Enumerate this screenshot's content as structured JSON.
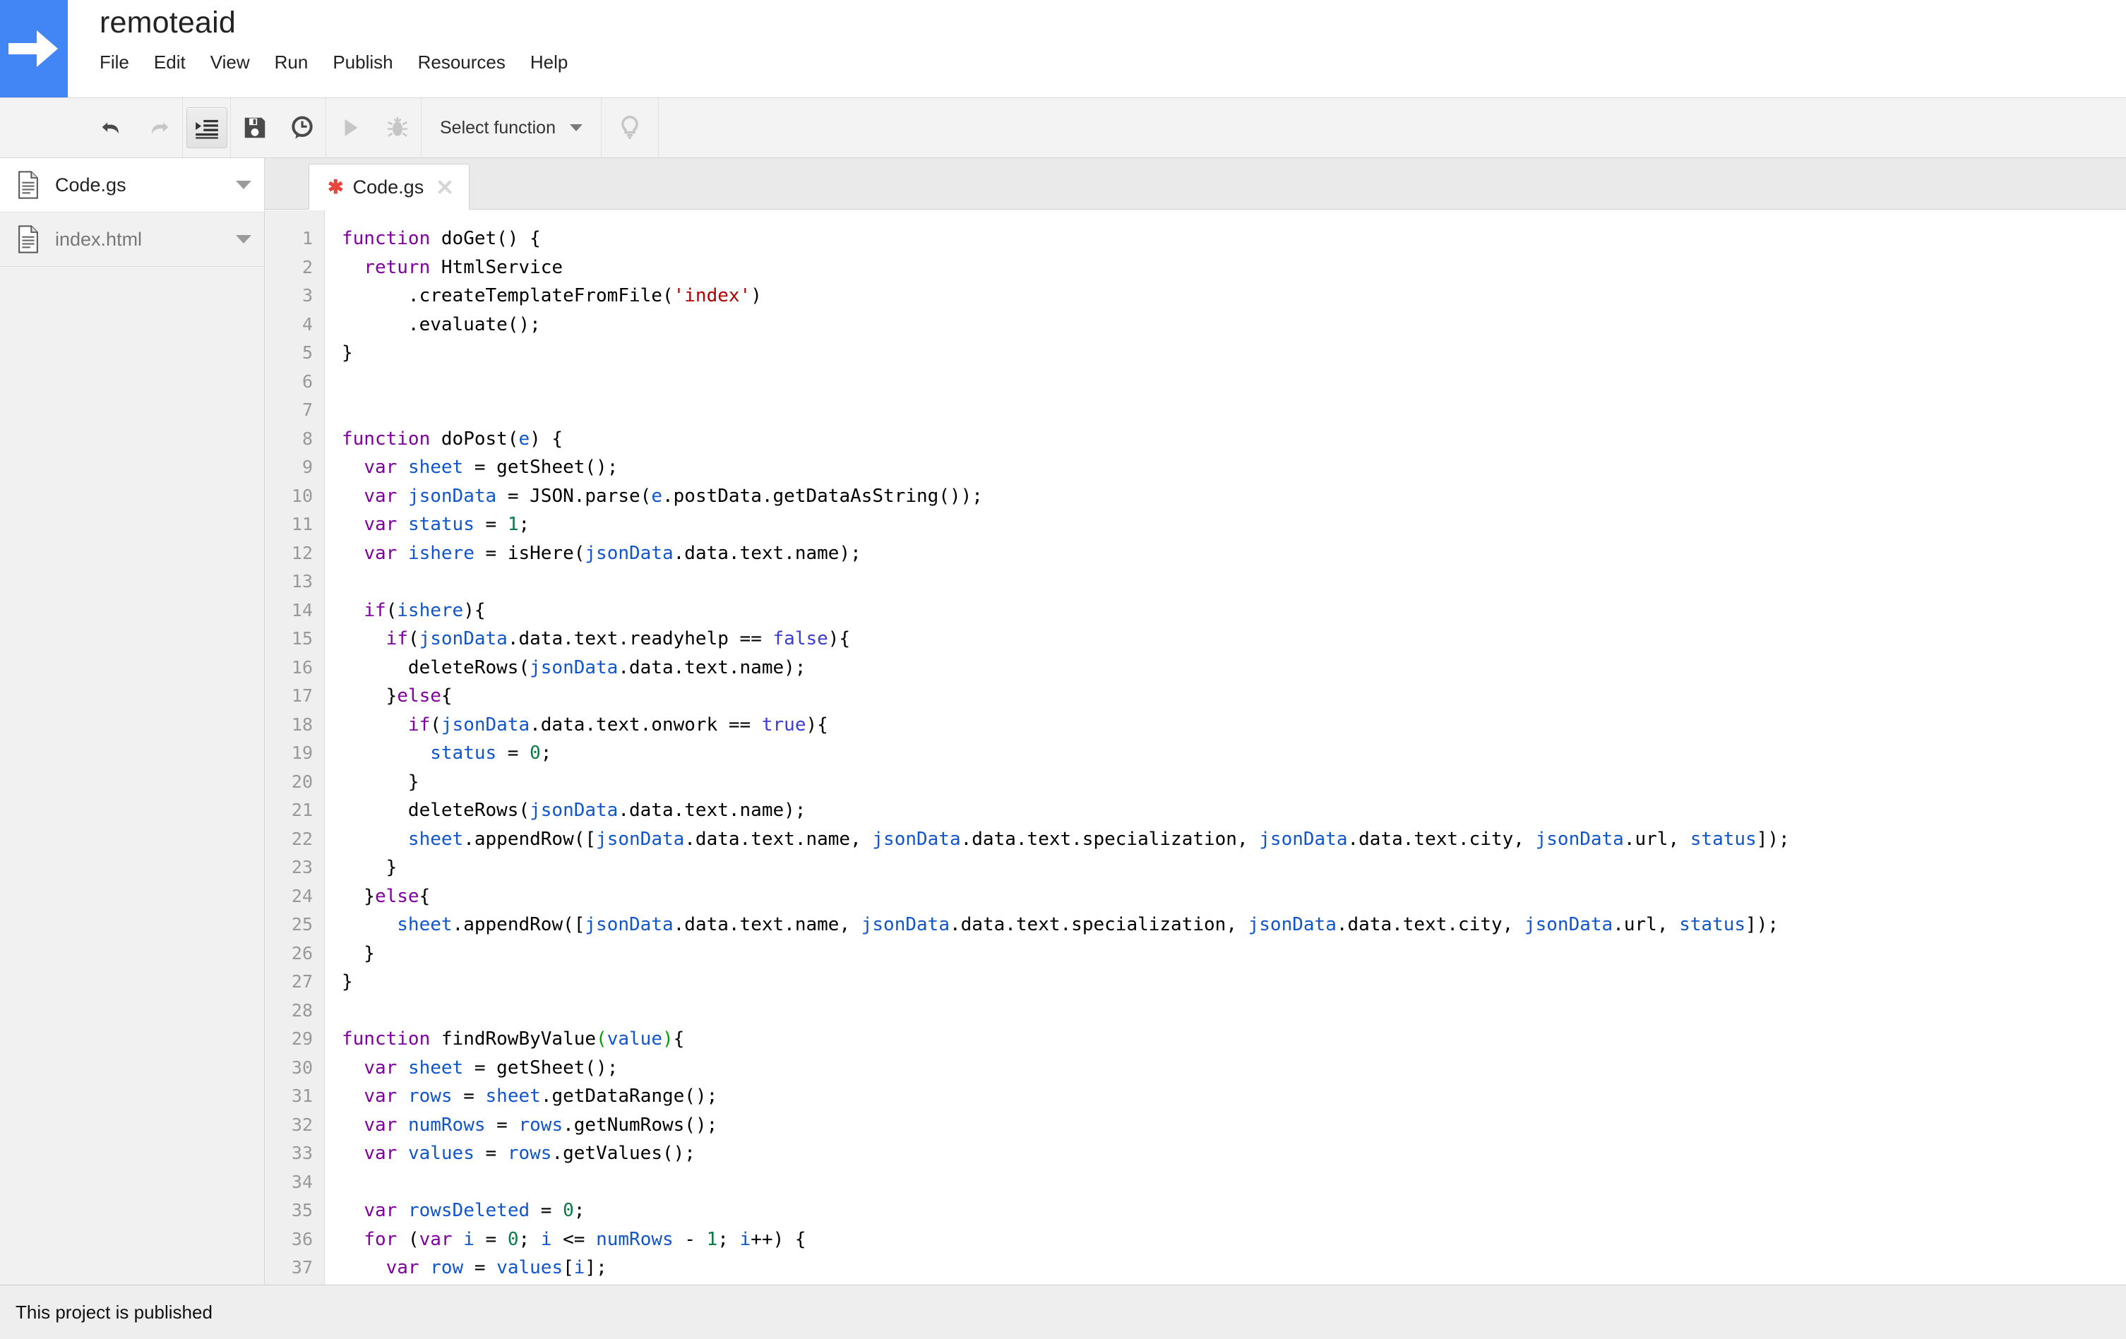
{
  "header": {
    "logo_icon": "arrow-right-icon",
    "logo_color": "#4285f4",
    "project_title": "remoteaid",
    "menu": [
      "File",
      "Edit",
      "View",
      "Run",
      "Publish",
      "Resources",
      "Help"
    ]
  },
  "toolbar": {
    "buttons": [
      {
        "name": "undo-button",
        "icon": "undo-icon",
        "enabled": true,
        "active": false
      },
      {
        "name": "redo-button",
        "icon": "redo-icon",
        "enabled": false,
        "active": false
      },
      {
        "name": "indent-button",
        "icon": "indent-icon",
        "enabled": true,
        "active": true
      },
      {
        "name": "save-button",
        "icon": "floppy-disk-icon",
        "enabled": true,
        "active": false
      },
      {
        "name": "version-history-button",
        "icon": "clock-icon",
        "enabled": true,
        "active": false
      },
      {
        "name": "run-button",
        "icon": "play-icon",
        "enabled": false,
        "active": false
      },
      {
        "name": "debug-button",
        "icon": "bug-icon",
        "enabled": false,
        "active": false
      }
    ],
    "function_select": {
      "label": "Select function",
      "caret_icon": "chevron-down-icon"
    },
    "help_button": {
      "name": "lightbulb-button",
      "icon": "lightbulb-icon"
    }
  },
  "sidebar": {
    "files": [
      {
        "label": "Code.gs",
        "icon": "file-icon",
        "selected": true,
        "caret_icon": "chevron-down-icon"
      },
      {
        "label": "index.html",
        "icon": "file-icon",
        "selected": false,
        "caret_icon": "chevron-down-icon"
      }
    ]
  },
  "editor": {
    "tabs": [
      {
        "title": "Code.gs",
        "dirty_marker": "✱",
        "unsaved": true,
        "close_icon": "close-icon",
        "active": true
      }
    ],
    "first_line": 1,
    "last_line": 37,
    "lines": [
      {
        "n": 1,
        "tokens": [
          {
            "t": "function",
            "c": "kw"
          },
          {
            "t": " doGet() {",
            "c": "pl"
          }
        ]
      },
      {
        "n": 2,
        "tokens": [
          {
            "t": "  ",
            "c": "pl"
          },
          {
            "t": "return",
            "c": "kw"
          },
          {
            "t": " HtmlService",
            "c": "pl"
          }
        ]
      },
      {
        "n": 3,
        "tokens": [
          {
            "t": "      .createTemplateFromFile(",
            "c": "pl"
          },
          {
            "t": "'index'",
            "c": "str"
          },
          {
            "t": ")",
            "c": "pl"
          }
        ]
      },
      {
        "n": 4,
        "tokens": [
          {
            "t": "      .evaluate();",
            "c": "pl"
          }
        ]
      },
      {
        "n": 5,
        "tokens": [
          {
            "t": "}",
            "c": "pl"
          }
        ]
      },
      {
        "n": 6,
        "tokens": []
      },
      {
        "n": 7,
        "tokens": []
      },
      {
        "n": 8,
        "tokens": [
          {
            "t": "function",
            "c": "kw"
          },
          {
            "t": " doPost(",
            "c": "pl"
          },
          {
            "t": "e",
            "c": "var"
          },
          {
            "t": ") {",
            "c": "pl"
          }
        ]
      },
      {
        "n": 9,
        "tokens": [
          {
            "t": "  ",
            "c": "pl"
          },
          {
            "t": "var",
            "c": "kw"
          },
          {
            "t": " ",
            "c": "pl"
          },
          {
            "t": "sheet",
            "c": "var"
          },
          {
            "t": " = getSheet();",
            "c": "pl"
          }
        ]
      },
      {
        "n": 10,
        "tokens": [
          {
            "t": "  ",
            "c": "pl"
          },
          {
            "t": "var",
            "c": "kw"
          },
          {
            "t": " ",
            "c": "pl"
          },
          {
            "t": "jsonData",
            "c": "var"
          },
          {
            "t": " = JSON.parse(",
            "c": "pl"
          },
          {
            "t": "e",
            "c": "var"
          },
          {
            "t": ".postData.getDataAsString());",
            "c": "pl"
          }
        ]
      },
      {
        "n": 11,
        "tokens": [
          {
            "t": "  ",
            "c": "pl"
          },
          {
            "t": "var",
            "c": "kw"
          },
          {
            "t": " ",
            "c": "pl"
          },
          {
            "t": "status",
            "c": "var"
          },
          {
            "t": " = ",
            "c": "pl"
          },
          {
            "t": "1",
            "c": "num"
          },
          {
            "t": ";",
            "c": "pl"
          }
        ]
      },
      {
        "n": 12,
        "tokens": [
          {
            "t": "  ",
            "c": "pl"
          },
          {
            "t": "var",
            "c": "kw"
          },
          {
            "t": " ",
            "c": "pl"
          },
          {
            "t": "ishere",
            "c": "var"
          },
          {
            "t": " = isHere(",
            "c": "pl"
          },
          {
            "t": "jsonData",
            "c": "var"
          },
          {
            "t": ".data.text.name);",
            "c": "pl"
          }
        ]
      },
      {
        "n": 13,
        "tokens": []
      },
      {
        "n": 14,
        "tokens": [
          {
            "t": "  ",
            "c": "pl"
          },
          {
            "t": "if",
            "c": "kw"
          },
          {
            "t": "(",
            "c": "pl"
          },
          {
            "t": "ishere",
            "c": "var"
          },
          {
            "t": "){",
            "c": "pl"
          }
        ]
      },
      {
        "n": 15,
        "tokens": [
          {
            "t": "    ",
            "c": "pl"
          },
          {
            "t": "if",
            "c": "kw"
          },
          {
            "t": "(",
            "c": "pl"
          },
          {
            "t": "jsonData",
            "c": "var"
          },
          {
            "t": ".data.text.readyhelp == ",
            "c": "pl"
          },
          {
            "t": "false",
            "c": "bool"
          },
          {
            "t": "){",
            "c": "pl"
          }
        ]
      },
      {
        "n": 16,
        "tokens": [
          {
            "t": "      deleteRows(",
            "c": "pl"
          },
          {
            "t": "jsonData",
            "c": "var"
          },
          {
            "t": ".data.text.name);",
            "c": "pl"
          }
        ]
      },
      {
        "n": 17,
        "tokens": [
          {
            "t": "    }",
            "c": "pl"
          },
          {
            "t": "else",
            "c": "kw"
          },
          {
            "t": "{",
            "c": "pl"
          }
        ]
      },
      {
        "n": 18,
        "tokens": [
          {
            "t": "      ",
            "c": "pl"
          },
          {
            "t": "if",
            "c": "kw"
          },
          {
            "t": "(",
            "c": "pl"
          },
          {
            "t": "jsonData",
            "c": "var"
          },
          {
            "t": ".data.text.onwork == ",
            "c": "pl"
          },
          {
            "t": "true",
            "c": "bool"
          },
          {
            "t": "){",
            "c": "pl"
          }
        ]
      },
      {
        "n": 19,
        "tokens": [
          {
            "t": "        ",
            "c": "pl"
          },
          {
            "t": "status",
            "c": "var"
          },
          {
            "t": " = ",
            "c": "pl"
          },
          {
            "t": "0",
            "c": "num"
          },
          {
            "t": ";",
            "c": "pl"
          }
        ]
      },
      {
        "n": 20,
        "tokens": [
          {
            "t": "      }",
            "c": "pl"
          }
        ]
      },
      {
        "n": 21,
        "tokens": [
          {
            "t": "      deleteRows(",
            "c": "pl"
          },
          {
            "t": "jsonData",
            "c": "var"
          },
          {
            "t": ".data.text.name);",
            "c": "pl"
          }
        ]
      },
      {
        "n": 22,
        "tokens": [
          {
            "t": "      ",
            "c": "pl"
          },
          {
            "t": "sheet",
            "c": "var"
          },
          {
            "t": ".appendRow([",
            "c": "pl"
          },
          {
            "t": "jsonData",
            "c": "var"
          },
          {
            "t": ".data.text.name, ",
            "c": "pl"
          },
          {
            "t": "jsonData",
            "c": "var"
          },
          {
            "t": ".data.text.specialization, ",
            "c": "pl"
          },
          {
            "t": "jsonData",
            "c": "var"
          },
          {
            "t": ".data.text.city, ",
            "c": "pl"
          },
          {
            "t": "jsonData",
            "c": "var"
          },
          {
            "t": ".url, ",
            "c": "pl"
          },
          {
            "t": "status",
            "c": "var"
          },
          {
            "t": "]);",
            "c": "pl"
          }
        ]
      },
      {
        "n": 23,
        "tokens": [
          {
            "t": "    }",
            "c": "pl"
          }
        ]
      },
      {
        "n": 24,
        "tokens": [
          {
            "t": "  }",
            "c": "pl"
          },
          {
            "t": "else",
            "c": "kw"
          },
          {
            "t": "{",
            "c": "pl"
          }
        ]
      },
      {
        "n": 25,
        "tokens": [
          {
            "t": "     ",
            "c": "pl"
          },
          {
            "t": "sheet",
            "c": "var"
          },
          {
            "t": ".appendRow([",
            "c": "pl"
          },
          {
            "t": "jsonData",
            "c": "var"
          },
          {
            "t": ".data.text.name, ",
            "c": "pl"
          },
          {
            "t": "jsonData",
            "c": "var"
          },
          {
            "t": ".data.text.specialization, ",
            "c": "pl"
          },
          {
            "t": "jsonData",
            "c": "var"
          },
          {
            "t": ".data.text.city, ",
            "c": "pl"
          },
          {
            "t": "jsonData",
            "c": "var"
          },
          {
            "t": ".url, ",
            "c": "pl"
          },
          {
            "t": "status",
            "c": "var"
          },
          {
            "t": "]);",
            "c": "pl"
          }
        ]
      },
      {
        "n": 26,
        "tokens": [
          {
            "t": "  }",
            "c": "pl"
          }
        ]
      },
      {
        "n": 27,
        "tokens": [
          {
            "t": "}",
            "c": "pl"
          }
        ]
      },
      {
        "n": 28,
        "tokens": []
      },
      {
        "n": 29,
        "tokens": [
          {
            "t": "function",
            "c": "kw"
          },
          {
            "t": " findRowByValue",
            "c": "pl"
          },
          {
            "t": "(",
            "c": "brk"
          },
          {
            "t": "value",
            "c": "var"
          },
          {
            "t": ")",
            "c": "brk"
          },
          {
            "t": "{",
            "c": "pl"
          }
        ]
      },
      {
        "n": 30,
        "tokens": [
          {
            "t": "  ",
            "c": "pl"
          },
          {
            "t": "var",
            "c": "kw"
          },
          {
            "t": " ",
            "c": "pl"
          },
          {
            "t": "sheet",
            "c": "var"
          },
          {
            "t": " = getSheet();",
            "c": "pl"
          }
        ]
      },
      {
        "n": 31,
        "tokens": [
          {
            "t": "  ",
            "c": "pl"
          },
          {
            "t": "var",
            "c": "kw"
          },
          {
            "t": " ",
            "c": "pl"
          },
          {
            "t": "rows",
            "c": "var"
          },
          {
            "t": " = ",
            "c": "pl"
          },
          {
            "t": "sheet",
            "c": "var"
          },
          {
            "t": ".getDataRange();",
            "c": "pl"
          }
        ]
      },
      {
        "n": 32,
        "tokens": [
          {
            "t": "  ",
            "c": "pl"
          },
          {
            "t": "var",
            "c": "kw"
          },
          {
            "t": " ",
            "c": "pl"
          },
          {
            "t": "numRows",
            "c": "var"
          },
          {
            "t": " = ",
            "c": "pl"
          },
          {
            "t": "rows",
            "c": "var"
          },
          {
            "t": ".getNumRows();",
            "c": "pl"
          }
        ]
      },
      {
        "n": 33,
        "tokens": [
          {
            "t": "  ",
            "c": "pl"
          },
          {
            "t": "var",
            "c": "kw"
          },
          {
            "t": " ",
            "c": "pl"
          },
          {
            "t": "values",
            "c": "var"
          },
          {
            "t": " = ",
            "c": "pl"
          },
          {
            "t": "rows",
            "c": "var"
          },
          {
            "t": ".getValues();",
            "c": "pl"
          }
        ]
      },
      {
        "n": 34,
        "tokens": []
      },
      {
        "n": 35,
        "tokens": [
          {
            "t": "  ",
            "c": "pl"
          },
          {
            "t": "var",
            "c": "kw"
          },
          {
            "t": " ",
            "c": "pl"
          },
          {
            "t": "rowsDeleted",
            "c": "var"
          },
          {
            "t": " = ",
            "c": "pl"
          },
          {
            "t": "0",
            "c": "num"
          },
          {
            "t": ";",
            "c": "pl"
          }
        ]
      },
      {
        "n": 36,
        "tokens": [
          {
            "t": "  ",
            "c": "pl"
          },
          {
            "t": "for",
            "c": "kw"
          },
          {
            "t": " (",
            "c": "pl"
          },
          {
            "t": "var",
            "c": "kw"
          },
          {
            "t": " ",
            "c": "pl"
          },
          {
            "t": "i",
            "c": "var"
          },
          {
            "t": " = ",
            "c": "pl"
          },
          {
            "t": "0",
            "c": "num"
          },
          {
            "t": "; ",
            "c": "pl"
          },
          {
            "t": "i",
            "c": "var"
          },
          {
            "t": " <= ",
            "c": "pl"
          },
          {
            "t": "numRows",
            "c": "var"
          },
          {
            "t": " - ",
            "c": "pl"
          },
          {
            "t": "1",
            "c": "num"
          },
          {
            "t": "; ",
            "c": "pl"
          },
          {
            "t": "i",
            "c": "var"
          },
          {
            "t": "++) {",
            "c": "pl"
          }
        ]
      },
      {
        "n": 37,
        "tokens": [
          {
            "t": "    ",
            "c": "pl"
          },
          {
            "t": "var",
            "c": "kw"
          },
          {
            "t": " ",
            "c": "pl"
          },
          {
            "t": "row",
            "c": "var"
          },
          {
            "t": " = ",
            "c": "pl"
          },
          {
            "t": "values",
            "c": "var"
          },
          {
            "t": "[",
            "c": "pl"
          },
          {
            "t": "i",
            "c": "var"
          },
          {
            "t": "];",
            "c": "pl"
          }
        ]
      }
    ]
  },
  "statusbar": {
    "message": "This project is published"
  },
  "colors": {
    "brand_blue": "#4285f4",
    "keyword": "#8000a0",
    "variable": "#1155cc",
    "number": "#0a7a46",
    "string": "#b00000",
    "boolean": "#3b3bd6",
    "bracket_match": "#00a000",
    "dirty_marker": "#e8453c"
  }
}
